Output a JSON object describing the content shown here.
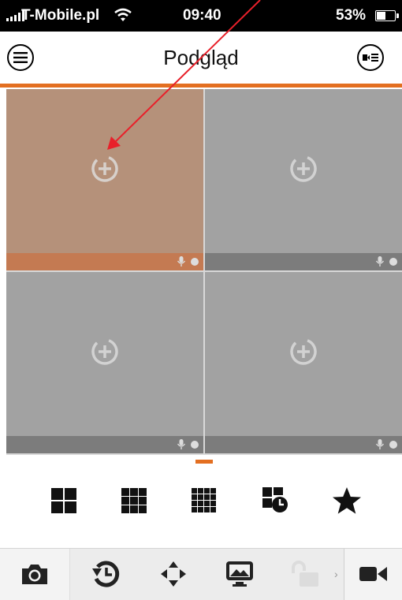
{
  "status_bar": {
    "carrier": "T-Mobile.pl",
    "time": "09:40",
    "battery": "53%"
  },
  "header": {
    "title": "Podgląd",
    "menu_icon": "hamburger-menu-icon",
    "channels_icon": "camera-list-icon"
  },
  "camera_grid": {
    "tiles": [
      {
        "state": "selected",
        "icon": "add-camera-icon"
      },
      {
        "state": "empty",
        "icon": "add-camera-icon"
      },
      {
        "state": "empty",
        "icon": "add-camera-icon"
      },
      {
        "state": "empty",
        "icon": "add-camera-icon"
      }
    ]
  },
  "layout_buttons": [
    "layout-4-icon",
    "layout-9-icon",
    "layout-16-icon",
    "playback-layout-icon",
    "favorites-star-icon"
  ],
  "bottom_toolbar": [
    "snapshot-camera-icon",
    "playback-icon",
    "ptz-arrows-icon",
    "image-quality-icon",
    "unlock-icon",
    "record-video-icon"
  ],
  "colors": {
    "accent": "#e36f21",
    "tile": "#a2a2a2",
    "tile_selected": "#b5917a",
    "annotation_arrow": "#e8202a"
  }
}
